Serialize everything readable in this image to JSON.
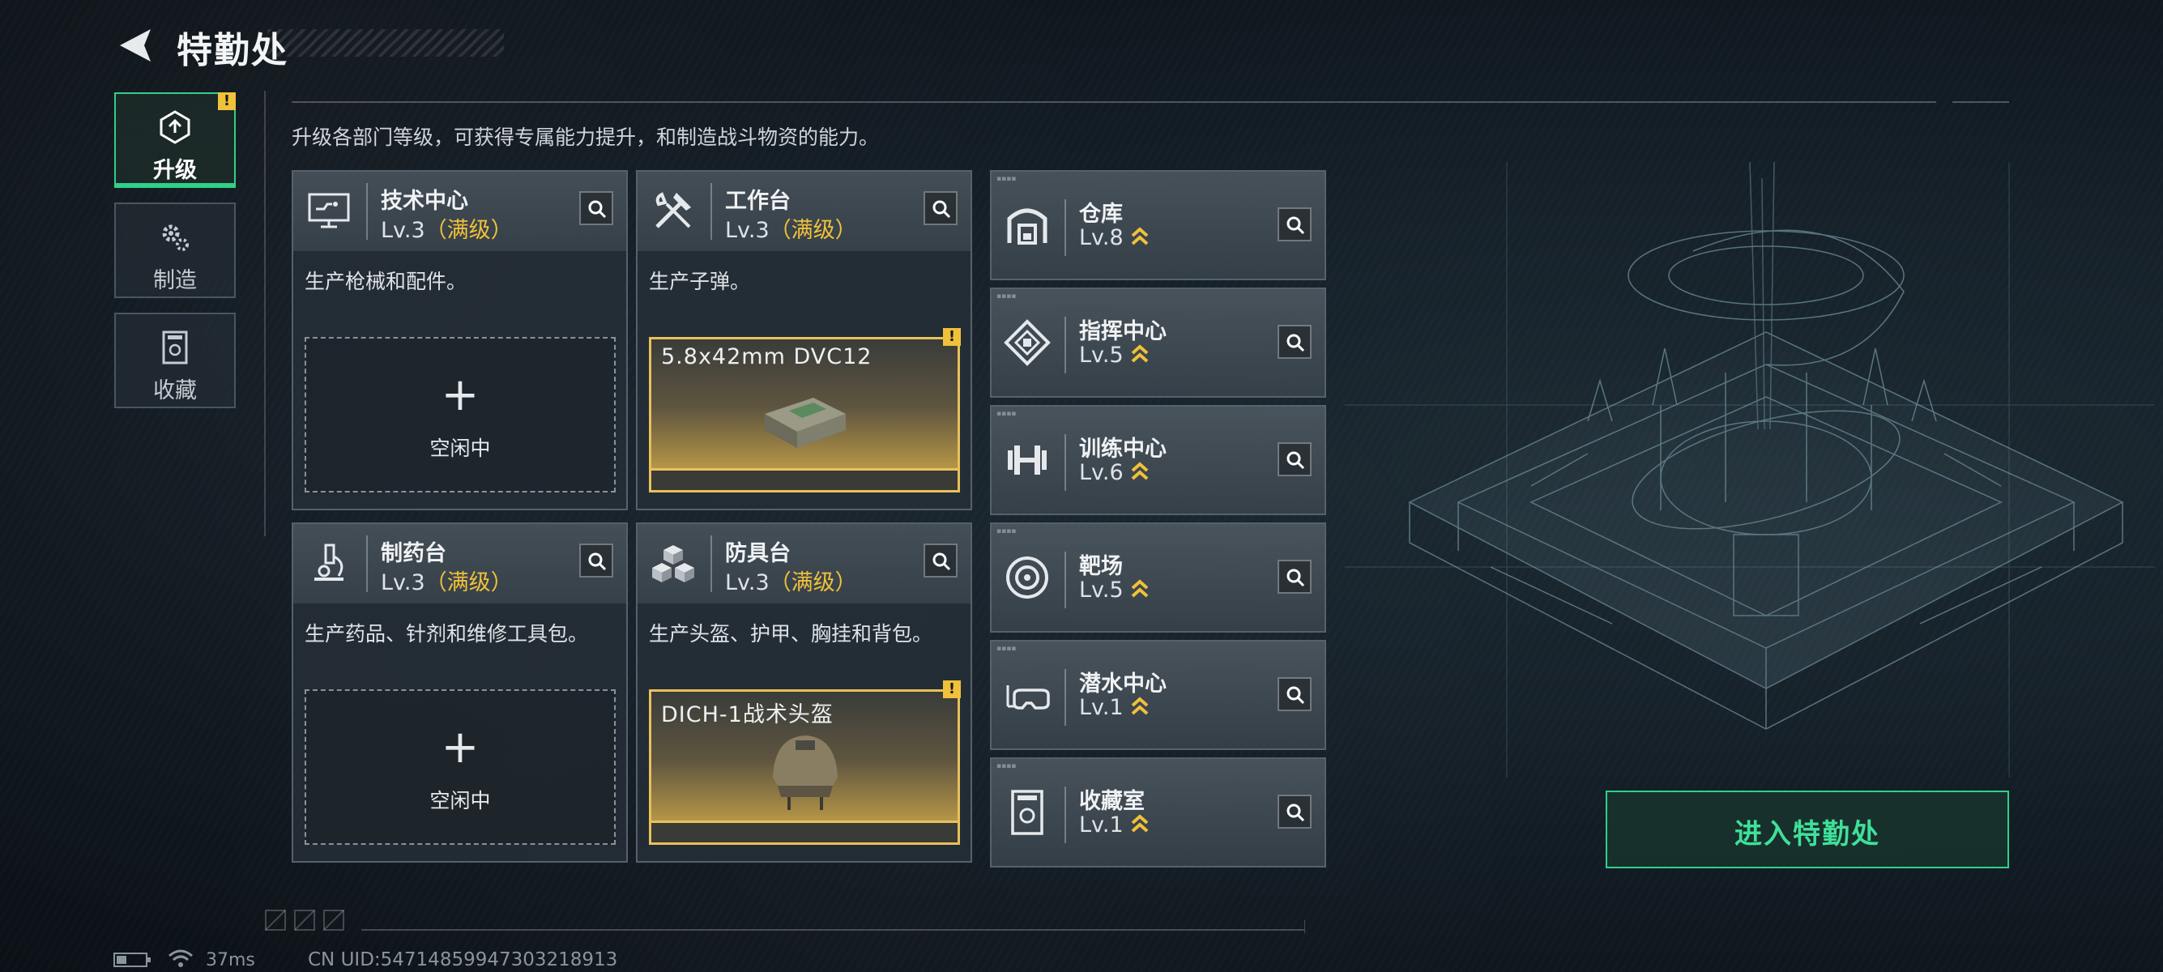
{
  "header": {
    "title": "特勤处"
  },
  "nav": [
    {
      "label": "升级",
      "icon": "upgrade-icon",
      "active": true,
      "warn": "!"
    },
    {
      "label": "制造",
      "icon": "gears-icon",
      "active": false
    },
    {
      "label": "收藏",
      "icon": "collection-icon",
      "active": false
    }
  ],
  "description": "升级各部门等级，可获得专属能力提升，和制造战斗物资的能力。",
  "cards": [
    {
      "name": "技术中心",
      "level": "Lv.3",
      "max": "（满级）",
      "desc": "生产枪械和配件。",
      "slot": {
        "state": "idle",
        "plus": "+",
        "label": "空闲中"
      },
      "icon": "monitor-icon"
    },
    {
      "name": "工作台",
      "level": "Lv.3",
      "max": "（满级）",
      "desc": "生产子弹。",
      "slot": {
        "state": "producing",
        "item": "5.8x42mm DVC12",
        "warn": "!"
      },
      "icon": "tools-icon"
    },
    {
      "name": "制药台",
      "level": "Lv.3",
      "max": "（满级）",
      "desc": "生产药品、针剂和维修工具包。",
      "slot": {
        "state": "idle",
        "plus": "+",
        "label": "空闲中"
      },
      "icon": "microscope-icon"
    },
    {
      "name": "防具台",
      "level": "Lv.3",
      "max": "（满级）",
      "desc": "生产头盔、护甲、胸挂和背包。",
      "slot": {
        "state": "producing",
        "item": "DICH-1战术头盔",
        "warn": "!"
      },
      "icon": "cubes-icon"
    }
  ],
  "departments": [
    {
      "name": "仓库",
      "level": "Lv.8",
      "icon": "warehouse-icon"
    },
    {
      "name": "指挥中心",
      "level": "Lv.5",
      "icon": "command-icon"
    },
    {
      "name": "训练中心",
      "level": "Lv.6",
      "icon": "dumbbell-icon"
    },
    {
      "name": "靶场",
      "level": "Lv.5",
      "icon": "target-icon"
    },
    {
      "name": "潜水中心",
      "level": "Lv.1",
      "icon": "diving-mask-icon"
    },
    {
      "name": "收藏室",
      "level": "Lv.1",
      "icon": "collection-room-icon"
    }
  ],
  "enter_button": "进入特勤处",
  "status": {
    "ping": "37ms",
    "uid": "CN UID:547148599473032189​13"
  },
  "colors": {
    "accent": "#2fd08a",
    "gold": "#f0c13a",
    "warn": "#f0c13a"
  }
}
